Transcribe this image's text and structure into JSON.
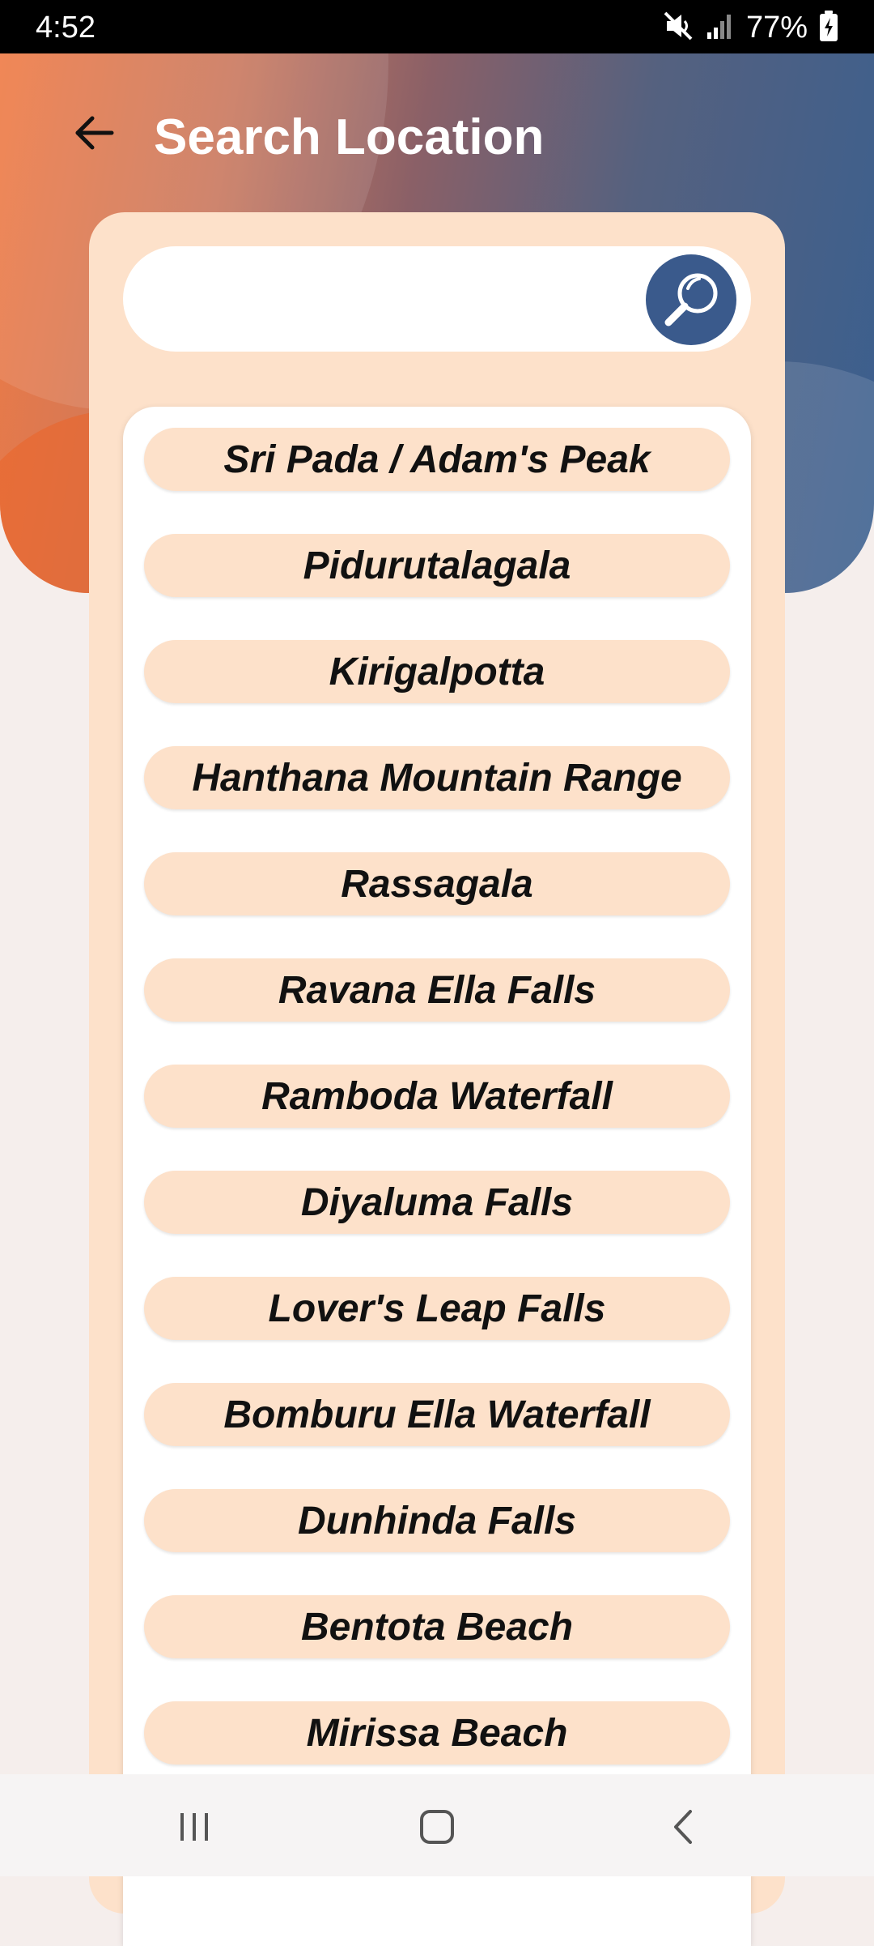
{
  "status_bar": {
    "time": "4:52",
    "battery": "77%",
    "icons": [
      "mute-icon",
      "signal-icon",
      "battery-icon"
    ]
  },
  "header": {
    "back_icon": "arrow-left-icon",
    "title": "Search Location"
  },
  "search": {
    "placeholder": "",
    "value": "",
    "button_icon": "magnifier-icon"
  },
  "results": [
    {
      "label": "Sri Pada / Adam's Peak"
    },
    {
      "label": "Pidurutalagala"
    },
    {
      "label": "Kirigalpotta"
    },
    {
      "label": "Hanthana Mountain Range"
    },
    {
      "label": "Rassagala"
    },
    {
      "label": "Ravana Ella Falls"
    },
    {
      "label": "Ramboda Waterfall"
    },
    {
      "label": "Diyaluma Falls"
    },
    {
      "label": "Lover's Leap Falls"
    },
    {
      "label": "Bomburu Ella Waterfall"
    },
    {
      "label": "Dunhinda Falls"
    },
    {
      "label": "Bentota Beach"
    },
    {
      "label": "Mirissa Beach"
    }
  ],
  "nav_bar": {
    "icons": [
      "recent-apps-icon",
      "home-icon",
      "back-icon"
    ]
  },
  "colors": {
    "header_gradient_start": "#ef7a44",
    "header_gradient_end": "#3a5f8f",
    "card_background": "#fde1ca",
    "search_button": "#3a5a8c",
    "page_background": "#f5eeec"
  }
}
